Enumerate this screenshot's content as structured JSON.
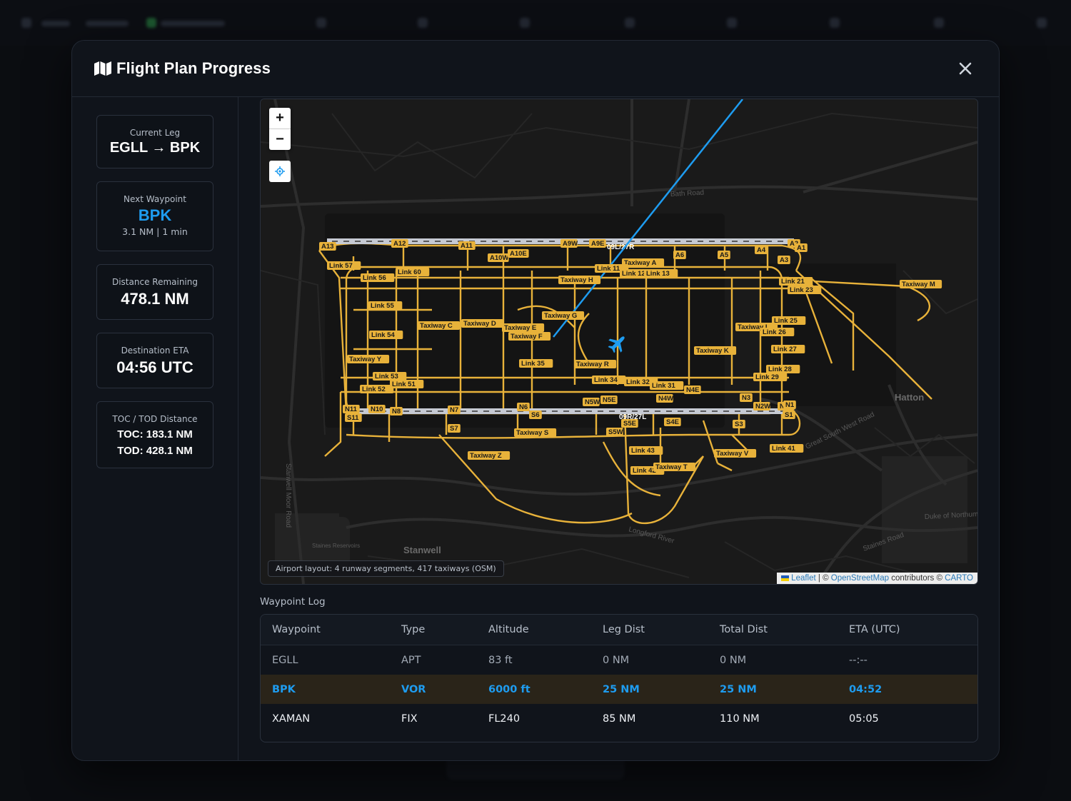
{
  "modal": {
    "title": "Flight Plan Progress",
    "title_icon": "map-icon",
    "close_icon": "close-icon"
  },
  "sidebar": {
    "current_leg": {
      "label": "Current Leg",
      "value": "EGLL → BPK"
    },
    "next_waypoint": {
      "label": "Next Waypoint",
      "value": "BPK",
      "detail": "3.1 NM | 1 min"
    },
    "distance_remaining": {
      "label": "Distance Remaining",
      "value": "478.1 NM"
    },
    "destination_eta": {
      "label": "Destination ETA",
      "value": "04:56 UTC"
    },
    "toc_tod": {
      "label": "TOC / TOD Distance",
      "toc": "TOC: 183.1 NM",
      "tod": "TOD: 428.1 NM"
    }
  },
  "map": {
    "zoom_in": "+",
    "zoom_out": "−",
    "locate_icon": "crosshair-icon",
    "aircraft_icon": "airplane-icon",
    "layout_note": "Airport layout: 4 runway segments, 417 taxiways (OSM)",
    "attribution": {
      "leaflet": "Leaflet",
      "sep": "|",
      "copy1": "©",
      "osm": "OpenStreetMap",
      "contributors": "contributors ©",
      "carto": "CARTO"
    },
    "runway_labels": [
      "09L/27R",
      "09R/27L"
    ],
    "place_labels": [
      "Hatton",
      "Stanwell",
      "Bath Road",
      "Staines Reservoirs",
      "Duke of Northumberland's River",
      "Longford River",
      "Great South West Road",
      "Stanwell Moor Road",
      "Staines Road"
    ],
    "taxiway_labels": [
      "A13",
      "A12",
      "A11",
      "A10W",
      "A10E",
      "A9W",
      "A9E",
      "A6",
      "A5",
      "A4",
      "A3",
      "A2",
      "A1",
      "Link 57",
      "Link 56",
      "Link 60",
      "Link 55",
      "Link 54",
      "Link 53",
      "Link 52",
      "Link 51",
      "Taxiway Y",
      "Taxiway C",
      "Taxiway D",
      "Taxiway E",
      "Taxiway F",
      "Taxiway G",
      "Taxiway H",
      "Taxiway A",
      "Link 11",
      "Link 12",
      "Link 13",
      "Link 35",
      "Taxiway R",
      "Link 34",
      "Link 32",
      "Link 31",
      "N4E",
      "N4W",
      "N5E",
      "N5W",
      "Taxiway K",
      "Taxiway L",
      "Link 25",
      "Link 26",
      "Link 27",
      "Link 28",
      "Link 29",
      "Link 21",
      "Link 23",
      "Taxiway M",
      "N11",
      "S11",
      "N10",
      "N8",
      "N7",
      "N6",
      "S7",
      "S6",
      "Taxiway S",
      "Taxiway Z",
      "S5E",
      "S5W",
      "S4E",
      "Link 43",
      "Link 42",
      "Taxiway T",
      "S3",
      "Taxiway V",
      "Link 41",
      "N3",
      "N2W",
      "N2E",
      "N1",
      "S1"
    ]
  },
  "waypoint_log": {
    "title": "Waypoint Log",
    "columns": [
      "Waypoint",
      "Type",
      "Altitude",
      "Leg Dist",
      "Total Dist",
      "ETA (UTC)"
    ],
    "rows": [
      [
        "EGLL",
        "APT",
        "83 ft",
        "0 NM",
        "0 NM",
        "--:--"
      ],
      [
        "BPK",
        "VOR",
        "6000 ft",
        "25 NM",
        "25 NM",
        "04:52"
      ],
      [
        "XAMAN",
        "FIX",
        "FL240",
        "85 NM",
        "110 NM",
        "05:05"
      ]
    ],
    "active_row": 1
  },
  "colors": {
    "accent": "#1e9cf0",
    "taxiway": "#e8b23a",
    "route": "#1e9cf0",
    "active_row_bg": "#2a2419"
  }
}
